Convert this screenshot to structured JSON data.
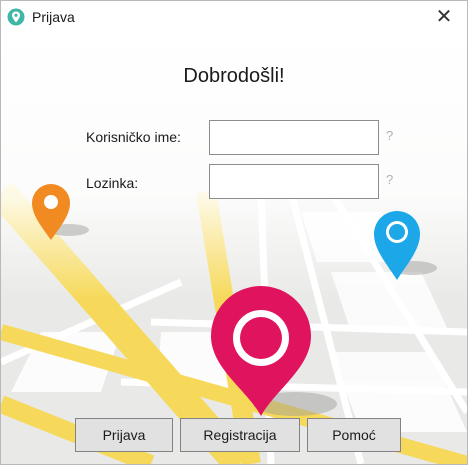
{
  "window": {
    "title": "Prijava",
    "close_glyph": "✕",
    "icon": "map-pin-icon"
  },
  "main": {
    "heading": "Dobrodošli!",
    "username_label": "Korisničko ime:",
    "username_value": "",
    "password_label": "Lozinka:",
    "password_value": "",
    "help_glyph": "?"
  },
  "buttons": {
    "login": "Prijava",
    "register": "Registracija",
    "help": "Pomoć"
  },
  "colors": {
    "pin_orange": "#f18a21",
    "pin_blue": "#1ca8e8",
    "pin_pink": "#e0135e",
    "road_yellow": "#f6d95a",
    "map_gray": "#e9e9e7"
  }
}
